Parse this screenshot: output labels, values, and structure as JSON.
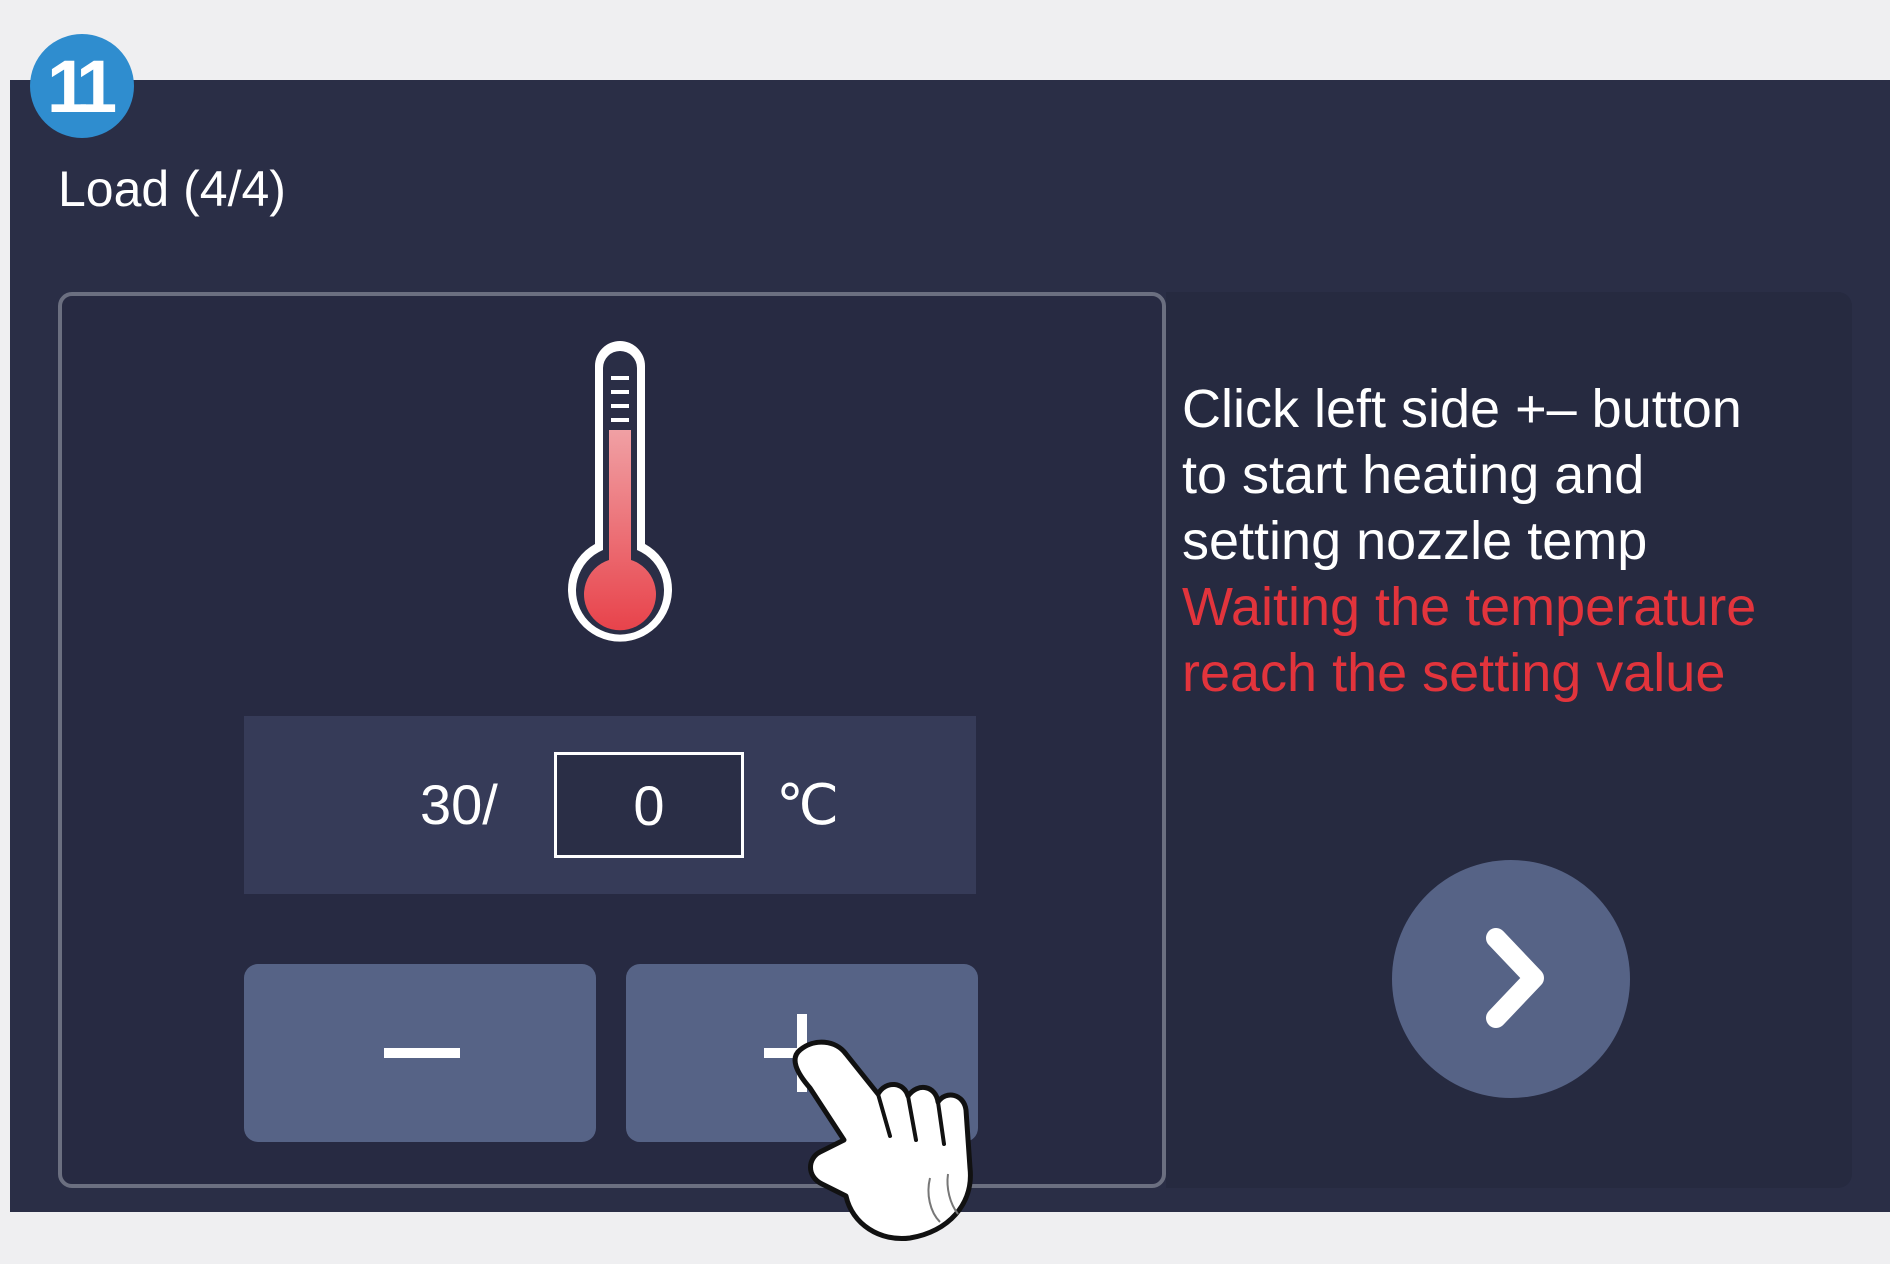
{
  "step_number": "11",
  "title": "Load (4/4)",
  "temperature": {
    "current": "30/",
    "target": "0",
    "unit": "℃"
  },
  "buttons": {
    "decrease": "minus-icon",
    "increase": "plus-icon",
    "next": "chevron-right-icon"
  },
  "instructions": {
    "line1": "Click left side +– button",
    "line2": "to start heating and",
    "line3": "setting nozzle temp",
    "warning_line1": "Waiting the temperature",
    "warning_line2": "reach the setting value"
  },
  "colors": {
    "background": "#2a2e46",
    "button": "#566386",
    "badge": "#2f8dcf",
    "warning": "#e2343c",
    "thermometer_fill": "#e8434b"
  }
}
